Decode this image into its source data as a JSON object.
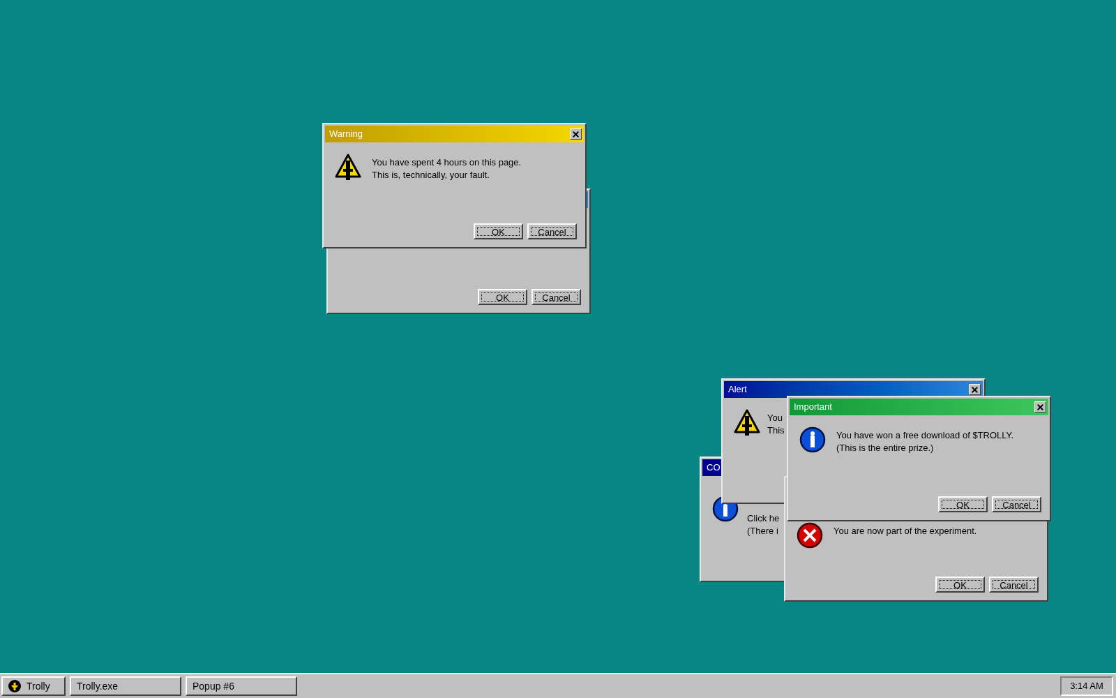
{
  "windows": [
    {
      "kind": "warning",
      "title": "Warning",
      "lines": [
        "You have spent 4 hours on this page.",
        "This is, technically, your fault."
      ],
      "buttons": [
        "OK",
        "Cancel"
      ]
    },
    {
      "kind": "alert",
      "buttons": [
        "OK",
        "Cancel"
      ]
    },
    {
      "kind": "alert",
      "title": "Alert",
      "lines": [
        "You",
        "This"
      ]
    },
    {
      "kind": "info",
      "title": "Important",
      "lines": [
        "You have won a free download of $TROLLY.",
        "(This is the entire prize.)"
      ],
      "buttons": [
        "OK",
        "Cancel"
      ]
    },
    {
      "kind": "notice",
      "title": "CO",
      "lines": [
        "Click he",
        "(There i"
      ]
    },
    {
      "kind": "error",
      "lines": [
        "You are now part of the experiment."
      ],
      "buttons": [
        "OK",
        "Cancel"
      ]
    }
  ],
  "taskbar": {
    "start": "Trolly",
    "tasks": [
      "Trolly.exe",
      "Popup #6"
    ],
    "clock": "3:14 AM"
  }
}
